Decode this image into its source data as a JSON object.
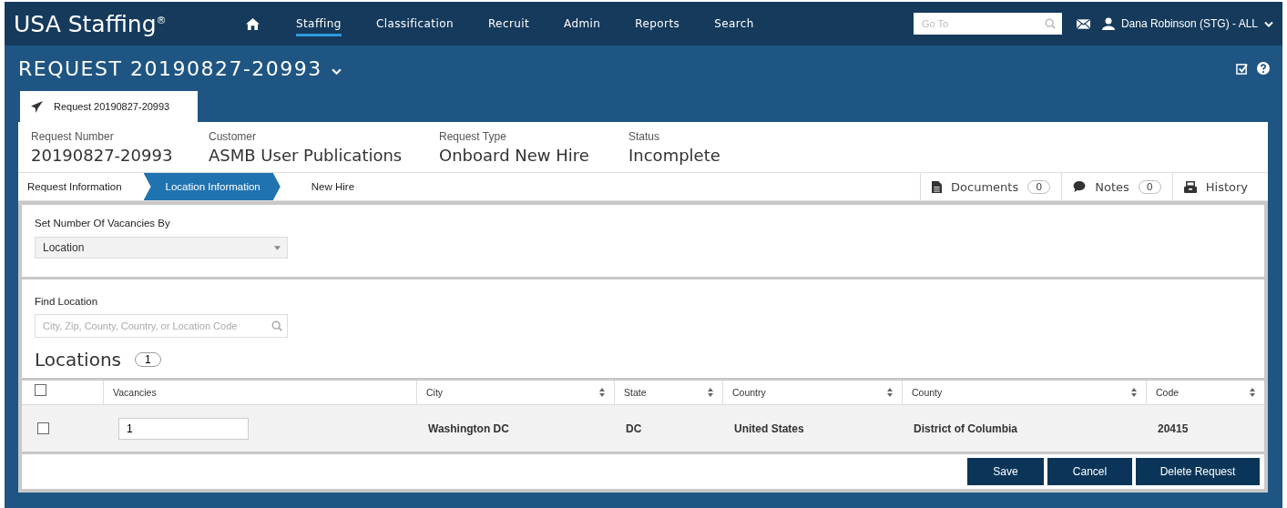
{
  "header": {
    "logo": "USA Staffing$^{®}$",
    "nav": [
      {
        "label": "Staffing",
        "selected": true
      },
      {
        "label": "Classification",
        "selected": false
      },
      {
        "label": "Recruit",
        "selected": false
      },
      {
        "label": "Admin",
        "selected": false
      },
      {
        "label": "Reports",
        "selected": false
      },
      {
        "label": "Search",
        "selected": false
      }
    ],
    "goto": {
      "placeholder": "Go To"
    },
    "user": "Dana Robinson (STG) - ALL"
  },
  "page_title": "REQUEST 20190827-20993",
  "tab": {
    "label": "Request 20190827-20993"
  },
  "summary": [
    {
      "label": "Request Number",
      "value": "20190827-20993"
    },
    {
      "label": "Customer",
      "value": "ASMB User Publications"
    },
    {
      "label": "Request Type",
      "value": "Onboard New Hire"
    },
    {
      "label": "Status",
      "value": "Incomplete"
    }
  ],
  "steps": [
    {
      "label": "Request Information",
      "selected": false
    },
    {
      "label": "Location Information",
      "selected": true
    },
    {
      "label": "New Hire",
      "selected": false
    }
  ],
  "side_tabs": [
    {
      "kind": "documents",
      "label": "Documents",
      "count": "0"
    },
    {
      "kind": "notes",
      "label": "Notes",
      "count": "0"
    },
    {
      "kind": "history",
      "label": "History"
    }
  ],
  "vacancies_by": {
    "label": "Set Number Of Vacancies By",
    "value": "Location"
  },
  "find_location": {
    "label": "Find Location",
    "placeholder": "City, Zip, County, Country, or Location Code"
  },
  "locations": {
    "title": "Locations",
    "count": "1",
    "select_all_checked": false,
    "columns": [
      {
        "label": "Vacancies",
        "sortable": false
      },
      {
        "label": "City",
        "sortable": true
      },
      {
        "label": "State",
        "sortable": true
      },
      {
        "label": "Country",
        "sortable": true
      },
      {
        "label": "County",
        "sortable": true
      },
      {
        "label": "Code",
        "sortable": true
      }
    ],
    "rows": [
      {
        "checked": false,
        "cells": [
          "1",
          "Washington DC",
          "DC",
          "United States",
          "District of Columbia",
          "20415"
        ]
      }
    ]
  },
  "buttons": [
    "Save",
    "Cancel",
    "Delete Request"
  ]
}
